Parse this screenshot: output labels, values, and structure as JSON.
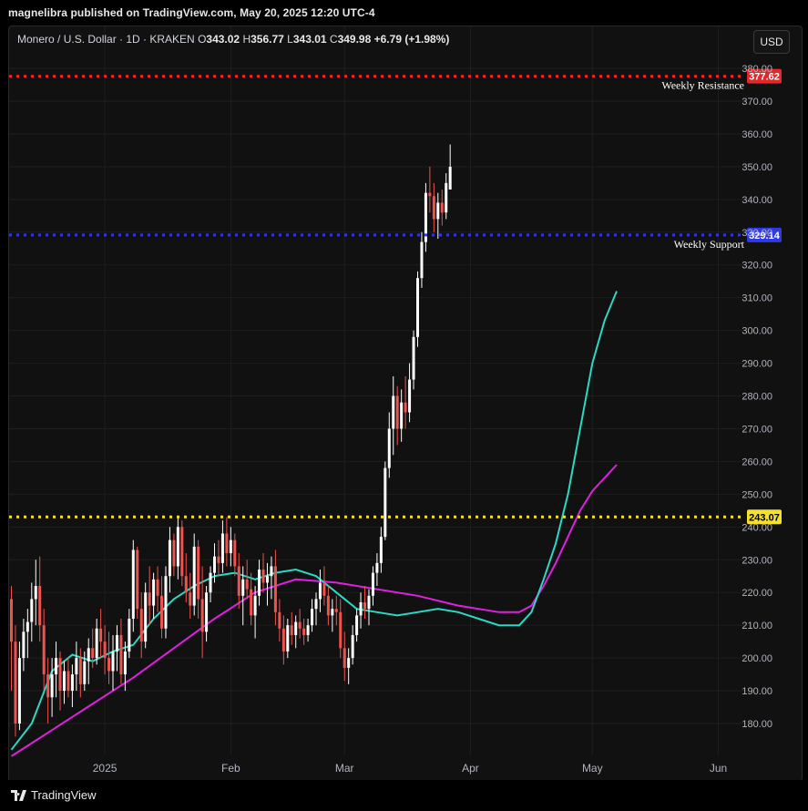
{
  "header": {
    "publisher": "magnelibra published on TradingView.com, May 20, 2025 12:20 UTC-4"
  },
  "legend": {
    "symbol": "Monero / U.S. Dollar · 1D · KRAKEN",
    "o_label": "O",
    "o_value": "343.02",
    "h_label": "H",
    "h_value": "356.77",
    "l_label": "L",
    "l_value": "343.01",
    "c_label": "C",
    "c_value": "349.98",
    "change": "+6.79 (+1.98%)"
  },
  "currency_button": "USD",
  "footer": {
    "brand": "TradingView"
  },
  "colors": {
    "bull": "#ffffff",
    "bear": "#ef5350",
    "ma_fast": "#2bd9c4",
    "ma_slow": "#e020e0",
    "resistance": "#e5262b",
    "support": "#2f3ae6",
    "yellow": "#f5e12a"
  },
  "chart_data": {
    "type": "candlestick",
    "title": "Monero / U.S. Dollar · 1D · KRAKEN",
    "xlabel": "",
    "ylabel": "USD",
    "ylim": [
      170,
      382
    ],
    "y_ticks": [
      "180.00",
      "190.00",
      "200.00",
      "210.00",
      "220.00",
      "230.00",
      "240.00",
      "250.00",
      "260.00",
      "270.00",
      "280.00",
      "290.00",
      "300.00",
      "310.00",
      "320.00",
      "330.00",
      "340.00",
      "350.00",
      "360.00",
      "370.00",
      "380.00"
    ],
    "x_ticks": [
      {
        "label": "2025",
        "day": 23
      },
      {
        "label": "Feb",
        "day": 54
      },
      {
        "label": "Mar",
        "day": 82
      },
      {
        "label": "Apr",
        "day": 113
      },
      {
        "label": "May",
        "day": 143
      },
      {
        "label": "Jun",
        "day": 174
      }
    ],
    "start_date": "2024-12-09",
    "horizontal_levels": [
      {
        "name": "Weekly Resistance",
        "value": 377.62,
        "label": "377.62",
        "color": "#e5262b"
      },
      {
        "name": "Weekly Support",
        "value": 329.14,
        "label": "329.14",
        "color": "#2f3ae6"
      },
      {
        "name": "",
        "value": 243.07,
        "label": "243.07",
        "color": "#f5e12a"
      }
    ],
    "candles": [
      [
        218,
        222,
        190,
        205
      ],
      [
        205,
        210,
        176,
        180
      ],
      [
        180,
        205,
        178,
        200
      ],
      [
        200,
        212,
        196,
        208
      ],
      [
        208,
        215,
        200,
        211
      ],
      [
        211,
        223,
        205,
        218
      ],
      [
        218,
        230,
        210,
        222
      ],
      [
        222,
        231,
        205,
        210
      ],
      [
        210,
        215,
        190,
        195
      ],
      [
        195,
        200,
        180,
        188
      ],
      [
        188,
        200,
        182,
        195
      ],
      [
        195,
        205,
        188,
        200
      ],
      [
        200,
        202,
        184,
        190
      ],
      [
        190,
        199,
        186,
        196
      ],
      [
        196,
        200,
        188,
        190
      ],
      [
        190,
        198,
        185,
        195
      ],
      [
        195,
        205,
        190,
        200
      ],
      [
        200,
        203,
        188,
        192
      ],
      [
        192,
        202,
        190,
        199
      ],
      [
        199,
        206,
        192,
        203
      ],
      [
        203,
        209,
        197,
        200
      ],
      [
        200,
        212,
        198,
        209
      ],
      [
        209,
        215,
        200,
        205
      ],
      [
        205,
        210,
        195,
        200
      ],
      [
        200,
        208,
        192,
        196
      ],
      [
        196,
        207,
        190,
        202
      ],
      [
        202,
        210,
        196,
        207
      ],
      [
        207,
        212,
        192,
        195
      ],
      [
        195,
        205,
        190,
        202
      ],
      [
        202,
        215,
        200,
        212
      ],
      [
        212,
        236,
        208,
        233
      ],
      [
        233,
        234,
        212,
        215
      ],
      [
        215,
        220,
        200,
        205
      ],
      [
        205,
        223,
        203,
        220
      ],
      [
        220,
        228,
        210,
        216
      ],
      [
        216,
        226,
        212,
        224
      ],
      [
        224,
        228,
        214,
        219
      ],
      [
        219,
        225,
        206,
        209
      ],
      [
        209,
        228,
        206,
        225
      ],
      [
        225,
        240,
        220,
        236
      ],
      [
        236,
        238,
        225,
        228
      ],
      [
        228,
        243,
        224,
        240
      ],
      [
        240,
        242,
        222,
        225
      ],
      [
        225,
        232,
        217,
        220
      ],
      [
        220,
        226,
        212,
        216
      ],
      [
        216,
        238,
        213,
        234
      ],
      [
        234,
        236,
        212,
        218
      ],
      [
        218,
        228,
        200,
        208
      ],
      [
        208,
        222,
        205,
        220
      ],
      [
        220,
        228,
        217,
        226
      ],
      [
        226,
        235,
        223,
        231
      ],
      [
        231,
        236,
        225,
        229
      ],
      [
        229,
        242,
        226,
        238
      ],
      [
        238,
        243,
        228,
        232
      ],
      [
        232,
        240,
        228,
        236
      ],
      [
        236,
        238,
        225,
        228
      ],
      [
        228,
        232,
        215,
        219
      ],
      [
        219,
        228,
        210,
        224
      ],
      [
        224,
        230,
        218,
        221
      ],
      [
        221,
        226,
        210,
        213
      ],
      [
        213,
        222,
        206,
        219
      ],
      [
        219,
        230,
        216,
        227
      ],
      [
        227,
        232,
        220,
        223
      ],
      [
        223,
        229,
        216,
        225
      ],
      [
        225,
        231,
        218,
        228
      ],
      [
        228,
        233,
        210,
        214
      ],
      [
        214,
        218,
        205,
        209
      ],
      [
        209,
        213,
        198,
        202
      ],
      [
        202,
        212,
        200,
        210
      ],
      [
        210,
        214,
        204,
        207
      ],
      [
        207,
        213,
        203,
        211
      ],
      [
        211,
        215,
        206,
        209
      ],
      [
        209,
        212,
        204,
        207
      ],
      [
        207,
        212,
        205,
        210
      ],
      [
        210,
        218,
        208,
        215
      ],
      [
        215,
        220,
        210,
        218
      ],
      [
        218,
        227,
        214,
        223
      ],
      [
        223,
        228,
        216,
        219
      ],
      [
        219,
        222,
        210,
        213
      ],
      [
        213,
        218,
        208,
        215
      ],
      [
        215,
        219,
        210,
        214
      ],
      [
        214,
        218,
        200,
        203
      ],
      [
        203,
        208,
        193,
        197
      ],
      [
        197,
        203,
        192,
        200
      ],
      [
        200,
        210,
        198,
        207
      ],
      [
        207,
        215,
        205,
        213
      ],
      [
        213,
        220,
        209,
        217
      ],
      [
        217,
        222,
        212,
        215
      ],
      [
        215,
        221,
        210,
        219
      ],
      [
        219,
        228,
        216,
        226
      ],
      [
        226,
        232,
        222,
        229
      ],
      [
        229,
        240,
        226,
        237
      ],
      [
        237,
        260,
        236,
        258
      ],
      [
        258,
        275,
        255,
        270
      ],
      [
        270,
        286,
        262,
        280
      ],
      [
        280,
        283,
        265,
        270
      ],
      [
        270,
        282,
        266,
        278
      ],
      [
        278,
        286,
        270,
        275
      ],
      [
        275,
        290,
        272,
        285
      ],
      [
        285,
        300,
        282,
        298
      ],
      [
        298,
        318,
        295,
        316
      ],
      [
        316,
        330,
        313,
        327
      ],
      [
        327,
        345,
        324,
        342
      ],
      [
        342,
        350,
        336,
        341
      ],
      [
        341,
        345,
        330,
        334
      ],
      [
        334,
        342,
        328,
        339
      ],
      [
        339,
        343,
        332,
        336
      ],
      [
        336,
        348,
        334,
        345
      ],
      [
        343.02,
        356.77,
        343.01,
        349.98
      ]
    ],
    "ma_fast": [
      [
        0,
        172
      ],
      [
        5,
        180
      ],
      [
        10,
        196
      ],
      [
        15,
        201
      ],
      [
        20,
        199
      ],
      [
        25,
        202
      ],
      [
        30,
        204
      ],
      [
        35,
        212
      ],
      [
        40,
        218
      ],
      [
        45,
        222
      ],
      [
        50,
        225
      ],
      [
        55,
        226
      ],
      [
        60,
        224
      ],
      [
        65,
        226
      ],
      [
        70,
        227
      ],
      [
        75,
        225
      ],
      [
        80,
        220
      ],
      [
        85,
        215
      ],
      [
        90,
        214
      ],
      [
        95,
        213
      ],
      [
        100,
        214
      ],
      [
        105,
        215
      ],
      [
        110,
        214
      ],
      [
        115,
        212
      ],
      [
        120,
        210
      ],
      [
        125,
        210
      ],
      [
        128,
        214
      ],
      [
        131,
        224
      ],
      [
        134,
        235
      ],
      [
        137,
        250
      ],
      [
        140,
        270
      ],
      [
        143,
        290
      ],
      [
        146,
        303
      ],
      [
        149,
        312
      ]
    ],
    "ma_slow": [
      [
        0,
        170
      ],
      [
        10,
        178
      ],
      [
        20,
        186
      ],
      [
        30,
        194
      ],
      [
        40,
        203
      ],
      [
        50,
        212
      ],
      [
        60,
        220
      ],
      [
        70,
        224
      ],
      [
        80,
        223
      ],
      [
        90,
        221
      ],
      [
        100,
        219
      ],
      [
        110,
        216
      ],
      [
        120,
        214
      ],
      [
        125,
        214
      ],
      [
        128,
        216
      ],
      [
        131,
        222
      ],
      [
        134,
        229
      ],
      [
        137,
        237
      ],
      [
        140,
        245
      ],
      [
        143,
        251
      ],
      [
        146,
        255
      ],
      [
        149,
        259
      ]
    ]
  }
}
